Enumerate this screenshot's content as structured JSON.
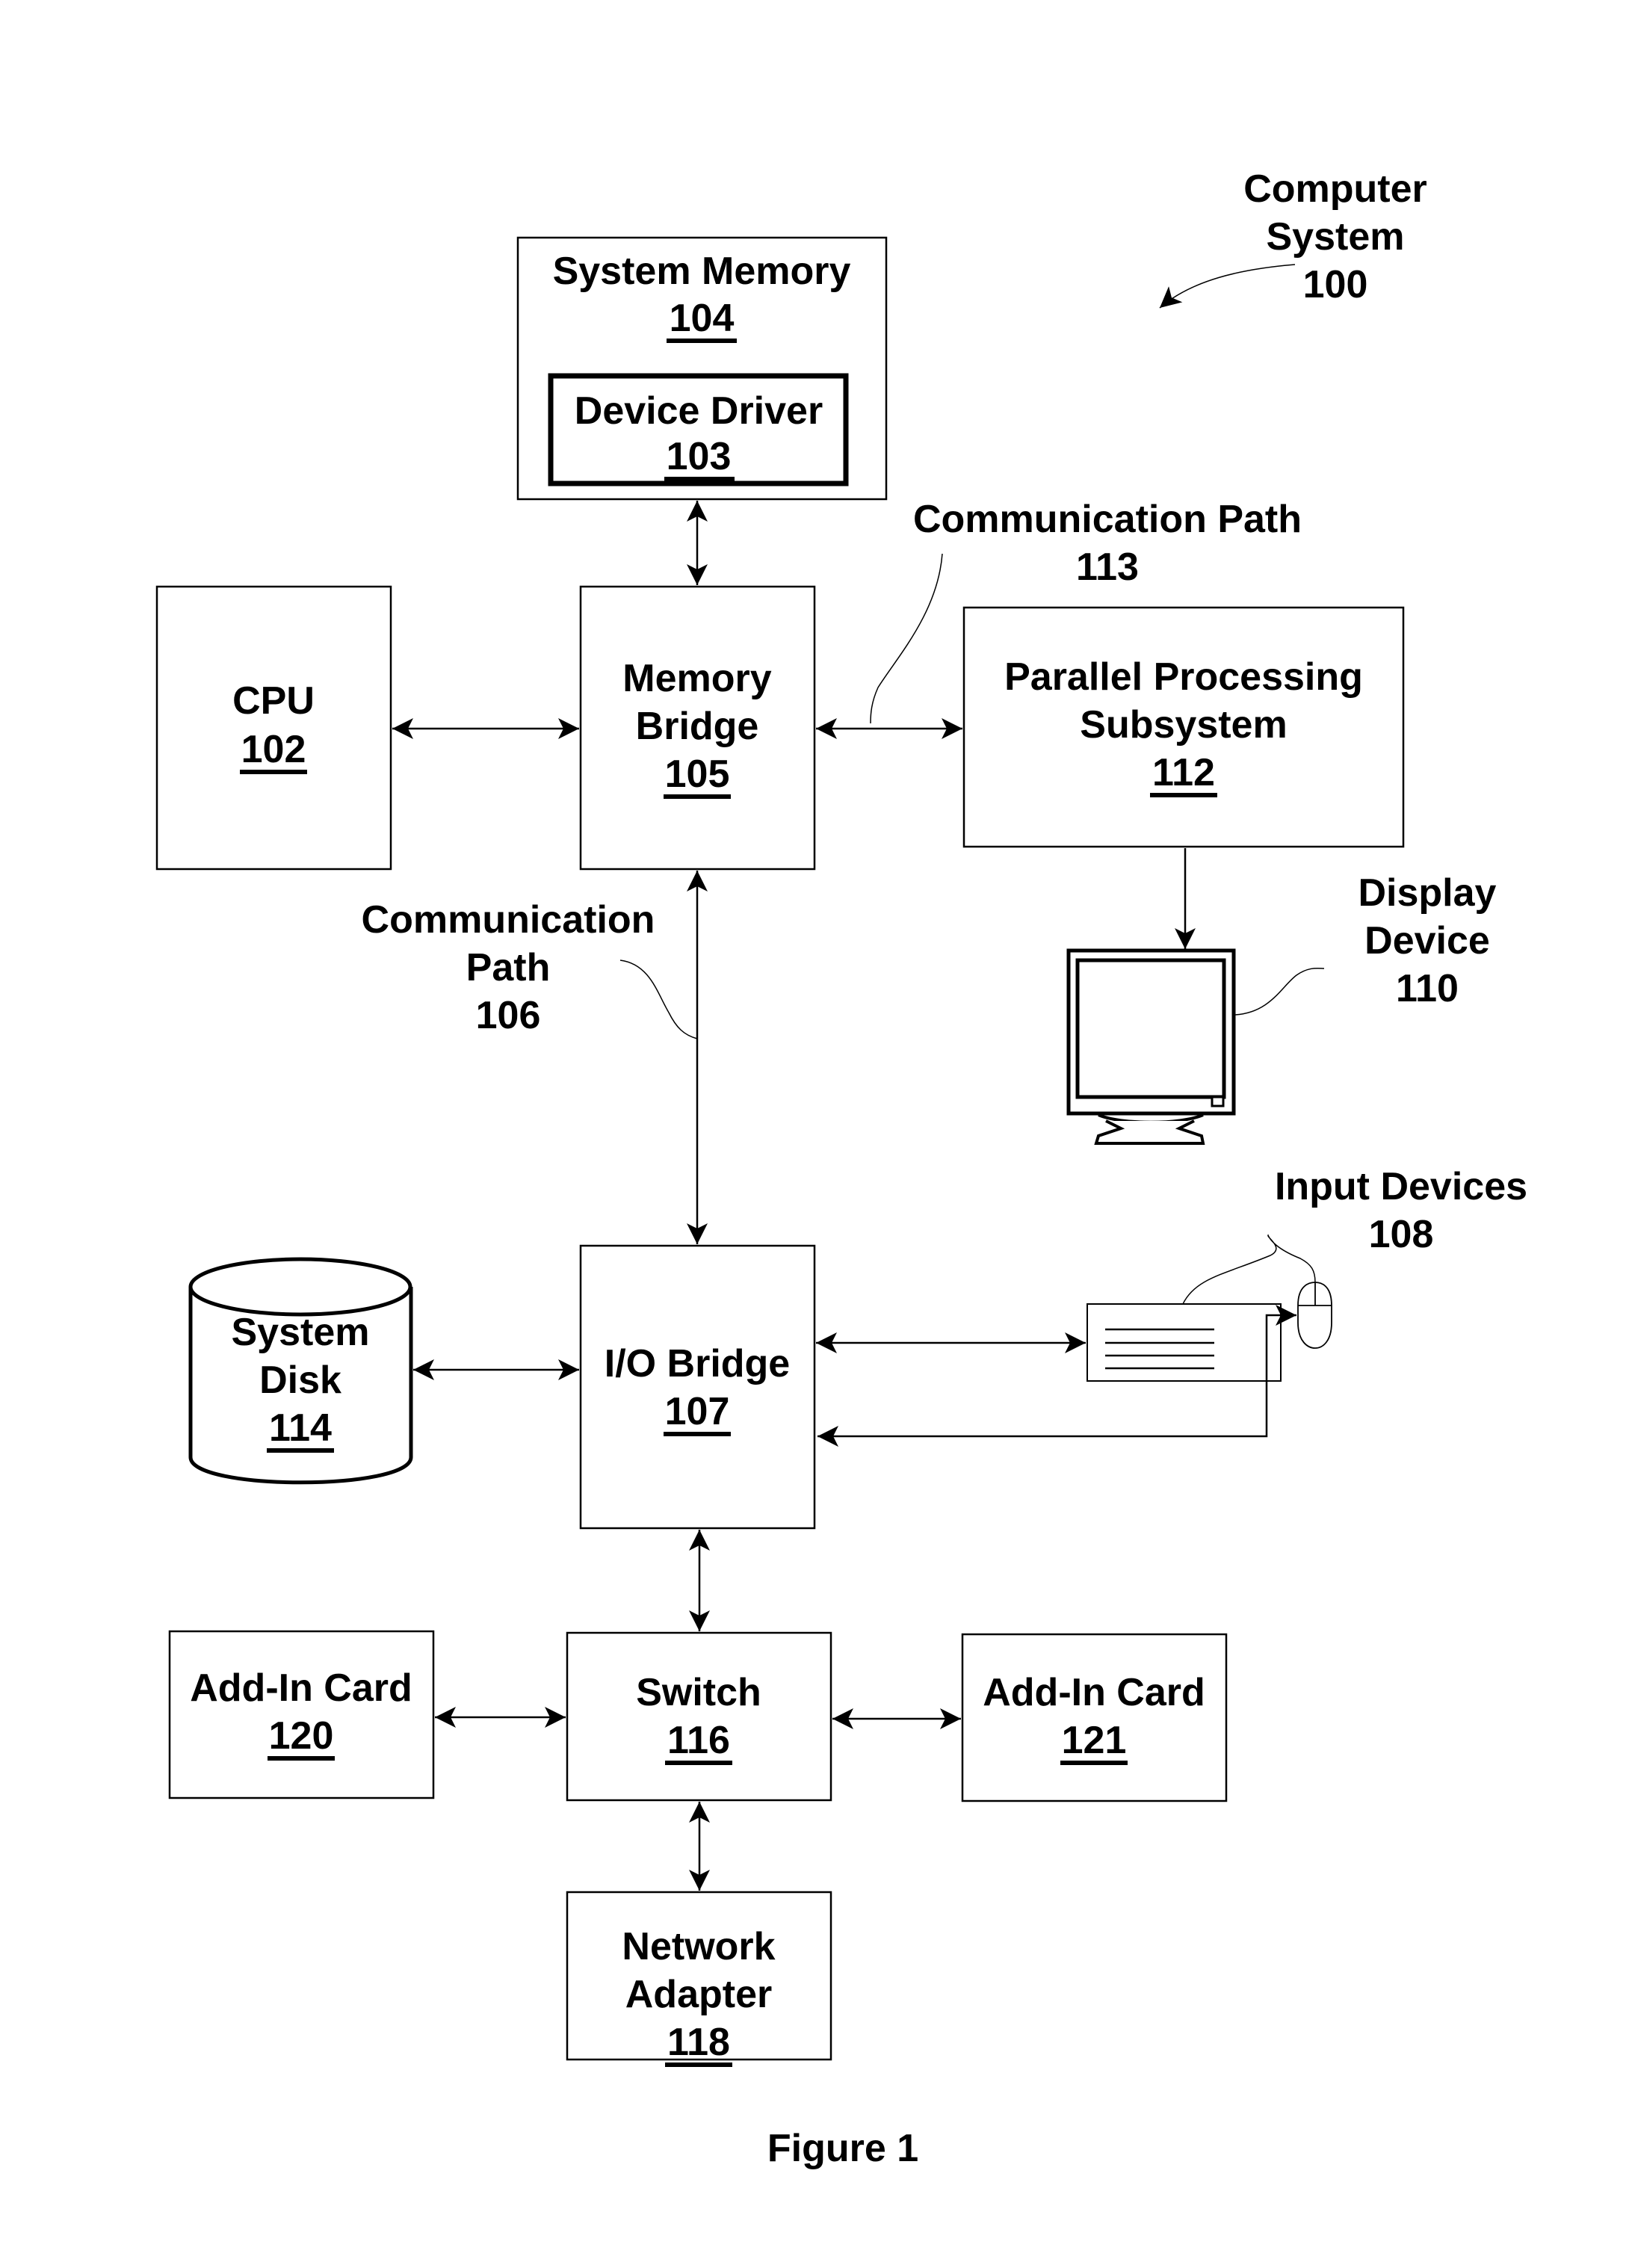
{
  "figure_title": "Figure 1",
  "system_label": {
    "lines": [
      "Computer",
      "System",
      "100"
    ]
  },
  "blocks": {
    "system_memory": {
      "name": "System Memory",
      "ref": "104"
    },
    "device_driver": {
      "name": "Device Driver",
      "ref": "103"
    },
    "cpu": {
      "name": "CPU",
      "ref": "102"
    },
    "memory_bridge": {
      "name_lines": [
        "Memory",
        "Bridge"
      ],
      "ref": "105"
    },
    "parallel_processing": {
      "name_lines": [
        "Parallel Processing",
        "Subsystem"
      ],
      "ref": "112"
    },
    "io_bridge": {
      "name": "I/O Bridge",
      "ref": "107"
    },
    "system_disk": {
      "name_lines": [
        "System",
        "Disk"
      ],
      "ref": "114"
    },
    "switch": {
      "name": "Switch",
      "ref": "116"
    },
    "add_in_card_120": {
      "name": "Add-In Card",
      "ref": "120"
    },
    "add_in_card_121": {
      "name": "Add-In Card",
      "ref": "121"
    },
    "network_adapter": {
      "name_lines": [
        "Network",
        "Adapter"
      ],
      "ref": "118"
    }
  },
  "callouts": {
    "comm_path_113": {
      "lines": [
        "Communication Path",
        "113"
      ]
    },
    "comm_path_106": {
      "lines": [
        "Communication",
        "Path",
        "106"
      ]
    },
    "display_device": {
      "lines": [
        "Display",
        "Device",
        "110"
      ]
    },
    "input_devices": {
      "lines": [
        "Input Devices",
        "108"
      ]
    }
  }
}
